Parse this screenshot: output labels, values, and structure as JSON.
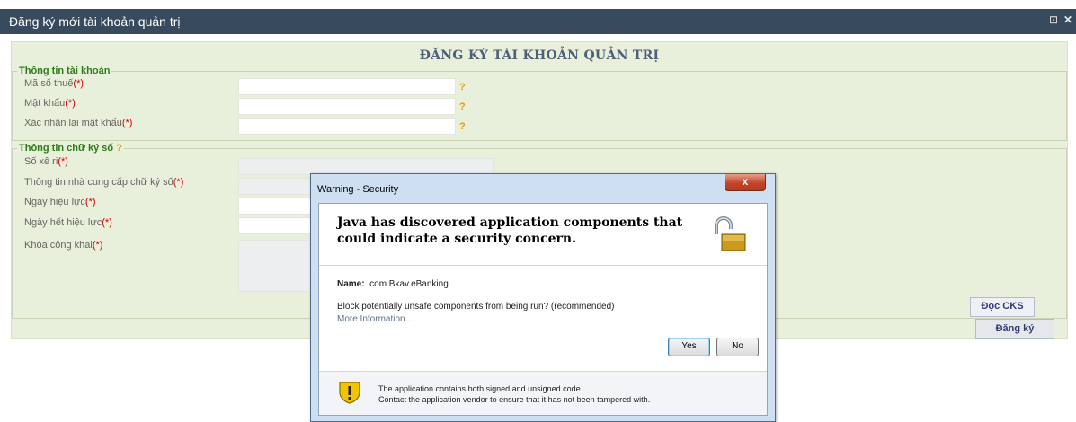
{
  "window": {
    "title": "Đăng ký mới tài khoản quản trị",
    "restore_icon": "⊡",
    "close_icon": "✕"
  },
  "form": {
    "title": "ĐĂNG KÝ TÀI KHOẢN QUẢN TRỊ",
    "account_section": {
      "legend": "Thông tin tài khoản",
      "fields": [
        {
          "label": "Mã số thuế",
          "required": "(*)",
          "value": "",
          "help": "?"
        },
        {
          "label": "Mật khẩu",
          "required": "(*)",
          "value": "",
          "help": "?"
        },
        {
          "label": "Xác nhận lại mật khẩu",
          "required": "(*)",
          "value": "",
          "help": "?"
        }
      ]
    },
    "signature_section": {
      "legend": "Thông tin chữ ký số",
      "legend_help": "?",
      "fields": [
        {
          "label": "Số xê ri",
          "required": "(*)",
          "value": ""
        },
        {
          "label": "Thông tin nhà cung cấp chữ ký số",
          "required": "(*)",
          "value": ""
        },
        {
          "label": "Ngày hiệu lực",
          "required": "(*)",
          "value": ""
        },
        {
          "label": "Ngày hết hiệu lực",
          "required": "(*)",
          "value": ""
        },
        {
          "label": "Khóa công khai",
          "required": "(*)",
          "value": ""
        }
      ],
      "read_cert_button": "Đọc CKS"
    },
    "register_button": "Đăng ký"
  },
  "dialog": {
    "title": "Warning - Security",
    "close_label": "x",
    "headline": "Java has discovered application components that could indicate a security concern.",
    "name_label": "Name:",
    "name_value": "com.Bkav.eBanking",
    "question": "Block potentially unsafe components from being run? (recommended)",
    "more_info": "More Information...",
    "yes_label": "Yes",
    "no_label": "No",
    "footer_line1": "The application contains both signed and unsigned code.",
    "footer_line2": "Contact the application vendor to ensure that it has not been tampered with.",
    "lock_icon": "padlock-unlocked-icon",
    "warning_icon": "warning-shield-icon"
  },
  "colors": {
    "titlebar": "#384a5e",
    "panel": "#e8efda",
    "legend": "#2d7d16",
    "required": "#d40000",
    "help": "#e39b00"
  }
}
